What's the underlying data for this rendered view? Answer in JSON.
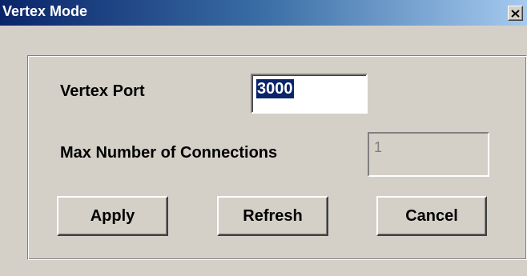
{
  "window": {
    "title": "Vertex Mode",
    "close_icon": "close-icon"
  },
  "form": {
    "vertex_port": {
      "label": "Vertex Port",
      "value": "3000",
      "selected": true
    },
    "max_connections": {
      "label": "Max Number of Connections",
      "value": "1",
      "disabled": true
    }
  },
  "buttons": {
    "apply": "Apply",
    "refresh": "Refresh",
    "cancel": "Cancel"
  },
  "colors": {
    "titlebar_start": "#0a246a",
    "titlebar_end": "#a6caf0",
    "face": "#d4d0c8",
    "selection": "#0a246a"
  }
}
